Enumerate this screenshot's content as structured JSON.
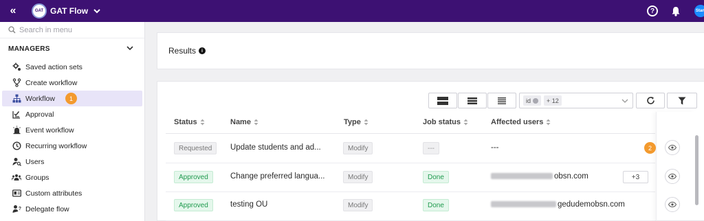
{
  "app": {
    "title": "GAT Flow",
    "logo_text": "GAT",
    "avatar_text": "Stan"
  },
  "sidebar": {
    "search_placeholder": "Search in menu",
    "section_title": "MANAGERS",
    "items": [
      {
        "label": "Saved action sets",
        "icon": "gear-settings-icon"
      },
      {
        "label": "Create workflow",
        "icon": "branch-icon"
      },
      {
        "label": "Workflow",
        "icon": "hierarchy-icon",
        "active": true
      },
      {
        "label": "Approval",
        "icon": "checklist-icon"
      },
      {
        "label": "Event workflow",
        "icon": "alarm-icon"
      },
      {
        "label": "Recurring workflow",
        "icon": "clock-icon"
      },
      {
        "label": "Users",
        "icon": "user-search-icon"
      },
      {
        "label": "Groups",
        "icon": "groups-icon"
      },
      {
        "label": "Custom attributes",
        "icon": "id-card-icon"
      },
      {
        "label": "Delegate flow",
        "icon": "user-question-icon"
      }
    ]
  },
  "markers": {
    "one": "1",
    "two": "2"
  },
  "results": {
    "title": "Results",
    "info": "i"
  },
  "toolbar": {
    "column_chip": "id",
    "more_chip": "+ 12"
  },
  "table": {
    "headers": {
      "status": "Status",
      "name": "Name",
      "type": "Type",
      "job_status": "Job status",
      "affected_users": "Affected users"
    },
    "rows": [
      {
        "status": "Requested",
        "name": "Update students and ad...",
        "type": "Modify",
        "job_status": "---",
        "affected_users": "---",
        "extra": ""
      },
      {
        "status": "Approved",
        "name": "Change preferred langua...",
        "type": "Modify",
        "job_status": "Done",
        "affected_users": "obsn.com",
        "extra": "+3"
      },
      {
        "status": "Approved",
        "name": "testing OU",
        "type": "Modify",
        "job_status": "Done",
        "affected_users": "gedudemobsn.com",
        "extra": ""
      }
    ]
  },
  "colors": {
    "topbar": "#3d1173",
    "accent_marker": "#f39a2e",
    "active_bg": "#e8e4f8",
    "approved": "#1f9a4e"
  }
}
